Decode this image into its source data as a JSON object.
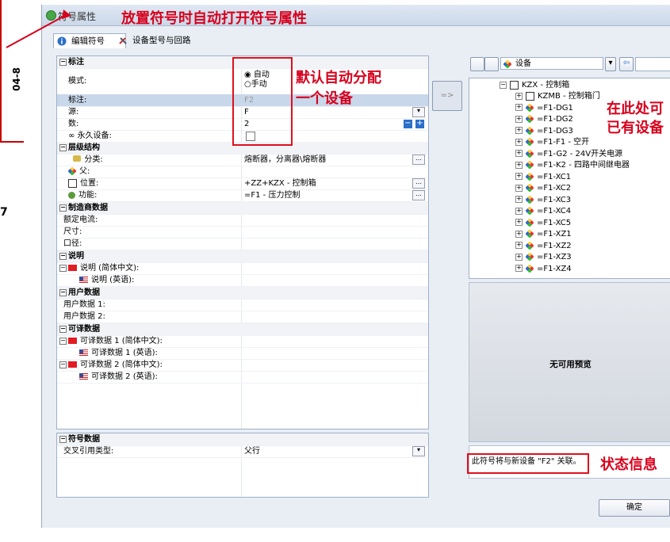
{
  "window": {
    "title": "符号属性"
  },
  "annotations": {
    "title_note": "放置符号时自动打开符号属性",
    "auto_assign": "默认自动分配\n一个设备",
    "existing_device": "在此处可\n已有设备",
    "status_info": "状态信息"
  },
  "tabs": [
    {
      "label": "编辑符号"
    },
    {
      "label": "设备型号与回路"
    }
  ],
  "properties": {
    "section_label": "标注",
    "mode_label": "模式:",
    "mode_options": [
      "自动",
      "手动"
    ],
    "mode_selected": "自动",
    "label_field": {
      "name": "标注:",
      "value": "F2"
    },
    "source_field": {
      "name": "源:",
      "value": "F"
    },
    "count_field": {
      "name": "数:",
      "value": "2"
    },
    "permanent_field": {
      "name": "永久设备:"
    },
    "hierarchy_section": "层级结构",
    "category": {
      "name": "分类:",
      "value": "熔断器，分离器\\熔断器"
    },
    "parent": {
      "name": "父:"
    },
    "location": {
      "name": "位置:",
      "value": "+ZZ+KZX - 控制箱"
    },
    "function": {
      "name": "功能:",
      "value": "=F1 - 压力控制"
    },
    "manufacturer_section": "制造商数据",
    "rated_current": "额定电流:",
    "size": "尺寸:",
    "caliber": "口径:",
    "description_section": "说明",
    "desc_cn": "说明 (简体中文):",
    "desc_en": "说明 (英语):",
    "user_data_section": "用户数据",
    "user_data_1": "用户数据 1:",
    "user_data_2": "用户数据 2:",
    "translatable_section": "可译数据",
    "trans1_cn": "可译数据 1 (简体中文):",
    "trans1_en": "可译数据 1 (英语):",
    "trans2_cn": "可译数据 2 (简体中文):",
    "trans2_en": "可译数据 2 (英语):"
  },
  "symbol_data": {
    "section_label": "符号数据",
    "xref_name": "交叉引用类型:",
    "xref_value": "父行"
  },
  "device_tree": {
    "dropdown_label": "设备",
    "root": "KZX - 控制箱",
    "items": [
      "KZMB - 控制箱门",
      "=F1-DG1",
      "=F1-DG2",
      "=F1-DG3",
      "=F1-F1 - 空开",
      "=F1-G2 - 24V开关电源",
      "=F1-K2 - 四路中间继电器",
      "=F1-XC1",
      "=F1-XC2",
      "=F1-XC3",
      "=F1-XC4",
      "=F1-XC5",
      "=F1-XZ1",
      "=F1-XZ2",
      "=F1-XZ3",
      "=F1-XZ4"
    ]
  },
  "preview": {
    "text": "无可用预览"
  },
  "status": {
    "text": "此符号将与新设备 \"F2\" 关联。"
  },
  "buttons": {
    "ok": "确定",
    "assign_arrow": "=>"
  },
  "drawing": {
    "label": "04-8"
  }
}
